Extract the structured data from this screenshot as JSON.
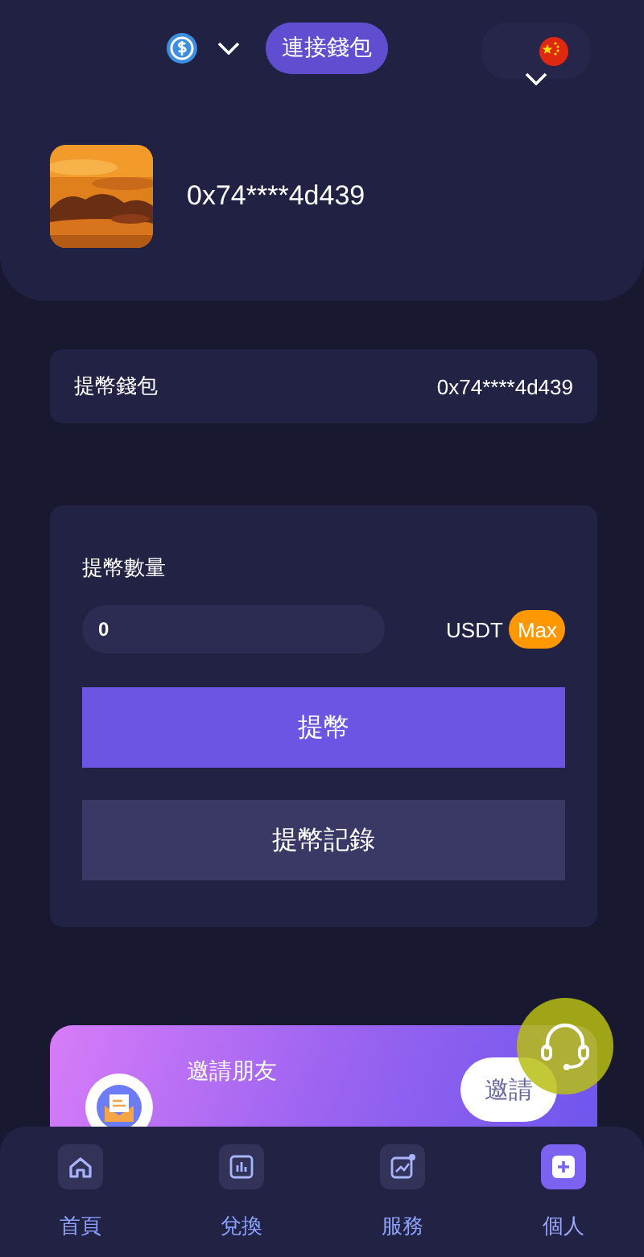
{
  "header": {
    "connect_button": "連接錢包",
    "address": "0x74****4d439"
  },
  "wallet": {
    "label": "提幣錢包",
    "address": "0x74****4d439"
  },
  "withdraw": {
    "label": "提幣數量",
    "amount": "0",
    "currency": "USDT",
    "max_button": "Max",
    "submit_button": "提幣",
    "records_button": "提幣記錄"
  },
  "invite": {
    "title": "邀請朋友",
    "button": "邀請"
  },
  "bottom_nav": [
    {
      "label": "首頁",
      "selected": false
    },
    {
      "label": "兌換",
      "selected": false
    },
    {
      "label": "服務",
      "selected": false
    },
    {
      "label": "個人",
      "selected": true
    }
  ]
}
